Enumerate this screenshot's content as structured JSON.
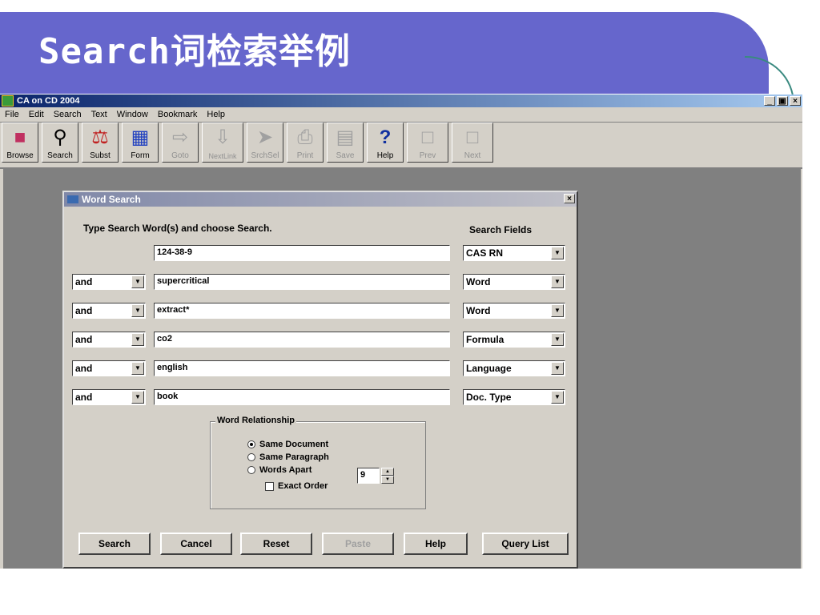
{
  "slide": {
    "title": "Search词检索举例"
  },
  "app": {
    "title": "CA on CD 2004",
    "menu": [
      "File",
      "Edit",
      "Search",
      "Text",
      "Window",
      "Bookmark",
      "Help"
    ],
    "toolbar": [
      {
        "label": "Browse",
        "icon": "books-icon",
        "enabled": true
      },
      {
        "label": "Search",
        "icon": "magnifier-icon",
        "enabled": true
      },
      {
        "label": "Subst",
        "icon": "flask-icon",
        "enabled": true
      },
      {
        "label": "Form",
        "icon": "beaker-icon",
        "enabled": true
      },
      {
        "label": "Goto",
        "icon": "goto-icon",
        "enabled": false
      },
      {
        "label": "NextLink",
        "icon": "nextlink-icon",
        "enabled": false
      },
      {
        "label": "SrchSel",
        "icon": "pointer-icon",
        "enabled": false
      },
      {
        "label": "Print",
        "icon": "printer-icon",
        "enabled": false
      },
      {
        "label": "Save",
        "icon": "disk-icon",
        "enabled": false
      },
      {
        "label": "Help",
        "icon": "question-icon",
        "enabled": true
      },
      {
        "label": "Prev",
        "icon": "prev-icon",
        "enabled": false
      },
      {
        "label": "Next",
        "icon": "next-icon",
        "enabled": false
      }
    ]
  },
  "dialog": {
    "title": "Word Search",
    "instruction": "Type Search Word(s) and choose Search.",
    "fields_header": "Search Fields",
    "rows": [
      {
        "op": "",
        "word": "124-38-9",
        "field": "CAS RN"
      },
      {
        "op": "and",
        "word": "supercritical",
        "field": "Word"
      },
      {
        "op": "and",
        "word": "extract*",
        "field": "Word"
      },
      {
        "op": "and",
        "word": "co2",
        "field": "Formula"
      },
      {
        "op": "and",
        "word": "english",
        "field": "Language"
      },
      {
        "op": "and",
        "word": "book",
        "field": "Doc. Type"
      }
    ],
    "relationship": {
      "caption": "Word Relationship",
      "options": [
        "Same Document",
        "Same Paragraph",
        "Words Apart"
      ],
      "selected": "Same Document",
      "words_apart_value": "9",
      "exact_order_label": "Exact Order"
    },
    "buttons": [
      "Search",
      "Cancel",
      "Reset",
      "Paste",
      "Help",
      "Query List"
    ]
  }
}
